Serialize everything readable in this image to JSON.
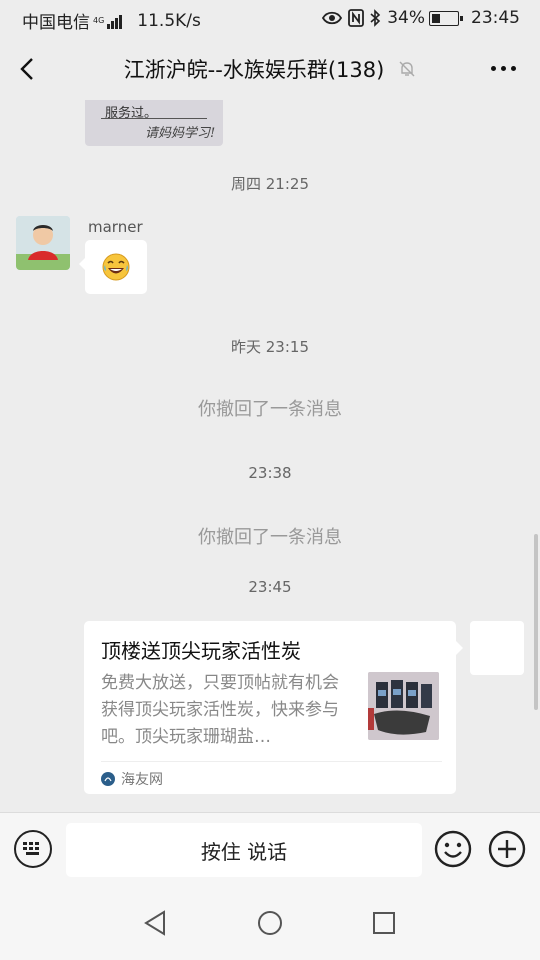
{
  "status_bar": {
    "carrier": "中国电信",
    "network_tag": "4G",
    "speed": "11.5K/s",
    "battery": "34%",
    "battery_level": 0.34,
    "time": "23:45",
    "icons": [
      "eye-icon",
      "nfc-icon",
      "bluetooth-icon",
      "signal-icon"
    ]
  },
  "header": {
    "title": "江浙沪皖--水族娱乐群(138)",
    "back_icon": "chevron-left-icon",
    "mute_icon": "bell-off-icon",
    "more_icon": "more-dots-icon"
  },
  "messages": {
    "image_text_1": "服务过。",
    "image_text_2": "请妈妈学习!",
    "time_1": "周四 21:25",
    "sender_name": "marner",
    "emoji": "😂",
    "time_2": "昨天 23:15",
    "recall_1": "你撤回了一条消息",
    "time_3": "23:38",
    "recall_2": "你撤回了一条消息",
    "time_4": "23:45"
  },
  "link_card": {
    "title": "顶楼送顶尖玩家活性炭",
    "description": "免费大放送，只要顶帖就有机会获得顶尖玩家活性炭，快来参与吧。顶尖玩家珊瑚盐…",
    "source": "海友网"
  },
  "input_bar": {
    "hold_to_talk": "按住 说话",
    "icons": [
      "keyboard-icon",
      "emoji-icon",
      "plus-icon"
    ]
  },
  "nav_bar": {
    "icons": [
      "nav-back-icon",
      "nav-home-icon",
      "nav-recent-icon"
    ]
  }
}
